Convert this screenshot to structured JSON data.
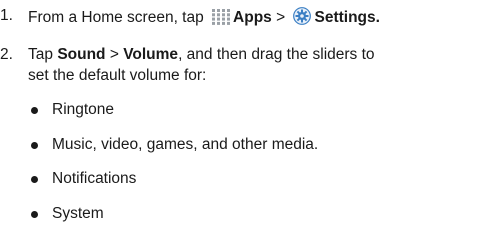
{
  "steps": [
    {
      "number": "1.",
      "prefix": "From a Home screen, tap",
      "apps_icon": "apps-grid-icon",
      "apps_label": "Apps",
      "separator": ">",
      "settings_icon": "settings-gear-icon",
      "settings_label": "Settings",
      "suffix": "."
    },
    {
      "number": "2.",
      "prefix": "Tap",
      "sound_label": "Sound",
      "separator": ">",
      "volume_label": "Volume",
      "rest_line1": ", and then drag the sliders to",
      "line2": "set the default volume for:"
    }
  ],
  "bullets": [
    "Ringtone",
    "Music, video, games, and other media.",
    "Notifications",
    "System"
  ],
  "colors": {
    "text": "#1a1a1a",
    "apps_icon": "#9aa0a6",
    "settings_icon": "#3b7fc4"
  }
}
